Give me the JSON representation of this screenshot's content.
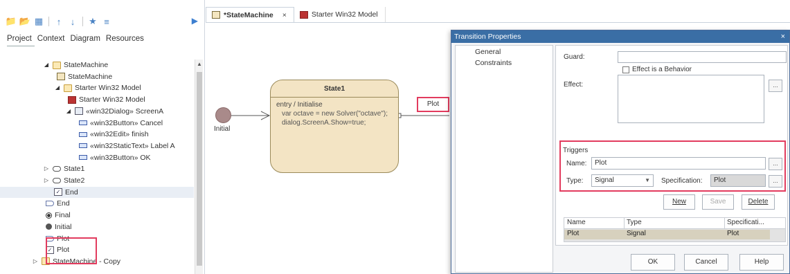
{
  "browser": {
    "tabs": [
      "Project",
      "Context",
      "Diagram",
      "Resources"
    ],
    "tree": [
      {
        "label": "StateMachine",
        "indent": 0,
        "icon": "folder-icon",
        "expander": "open"
      },
      {
        "label": "StateMachine",
        "indent": 1,
        "icon": "diagram-icon",
        "expander": ""
      },
      {
        "label": "Starter Win32 Model",
        "indent": 1,
        "icon": "folder-icon",
        "expander": "open"
      },
      {
        "label": "Starter Win32 Model",
        "indent": 2,
        "icon": "model-icon",
        "expander": ""
      },
      {
        "label": "«win32Dialog» ScreenA",
        "indent": 2,
        "icon": "dialog-icon",
        "expander": "open"
      },
      {
        "label": "«win32Button» Cancel",
        "indent": 3,
        "icon": "control-icon",
        "expander": ""
      },
      {
        "label": "«win32Edit» finish",
        "indent": 3,
        "icon": "control-icon",
        "expander": ""
      },
      {
        "label": "«win32StaticText» Label A",
        "indent": 3,
        "icon": "control-icon",
        "expander": ""
      },
      {
        "label": "«win32Button» OK",
        "indent": 3,
        "icon": "control-icon",
        "expander": ""
      },
      {
        "label": "State1",
        "indent": 0,
        "icon": "state-icon",
        "expander": "closed"
      },
      {
        "label": "State2",
        "indent": 0,
        "icon": "state-icon",
        "expander": "closed"
      },
      {
        "label": "End",
        "indent": 0,
        "icon": "end-icon",
        "expander": ""
      },
      {
        "label": "End",
        "indent": 0,
        "icon": "end-shape-icon",
        "expander": ""
      },
      {
        "label": "Final",
        "indent": 0,
        "icon": "final-icon",
        "expander": ""
      },
      {
        "label": "Initial",
        "indent": 0,
        "icon": "initial-icon",
        "expander": ""
      },
      {
        "label": "Plot",
        "indent": 0,
        "icon": "end-shape-icon",
        "expander": ""
      },
      {
        "label": "Plot",
        "indent": 0,
        "icon": "end-icon",
        "expander": ""
      },
      {
        "label": "StateMachine - Copy",
        "indent": -1,
        "icon": "folder-icon",
        "expander": "closed"
      }
    ]
  },
  "doc_tabs": {
    "active": "*StateMachine",
    "close": "×",
    "other": "Starter Win32 Model"
  },
  "diagram": {
    "state_name": "State1",
    "entry": "entry / Initialise",
    "code_line1": "var octave = new Solver(\"octave\");",
    "code_line2": "dialog.ScreenA.Show=true;",
    "initial_label": "Initial",
    "transition_label": "Plot"
  },
  "dialog": {
    "title": "Transition Properties",
    "close": "×",
    "nav": [
      "General",
      "Constraints"
    ],
    "guard_label": "Guard:",
    "guard_value": "",
    "effect_behavior_label": "Effect is a Behavior",
    "effect_label": "Effect:",
    "effect_value": "",
    "ellipsis": "...",
    "triggers_legend": "Triggers",
    "name_label": "Name:",
    "name_value": "Plot",
    "type_label": "Type:",
    "type_value": "Signal",
    "spec_label": "Specification:",
    "spec_value": "Plot",
    "btn_new": "New",
    "btn_save": "Save",
    "btn_delete": "Delete",
    "grid_headers": [
      "Name",
      "Type",
      "Specificati..."
    ],
    "grid_row": [
      "Plot",
      "Signal",
      "Plot"
    ],
    "btn_ok": "OK",
    "btn_cancel": "Cancel",
    "btn_help": "Help"
  }
}
